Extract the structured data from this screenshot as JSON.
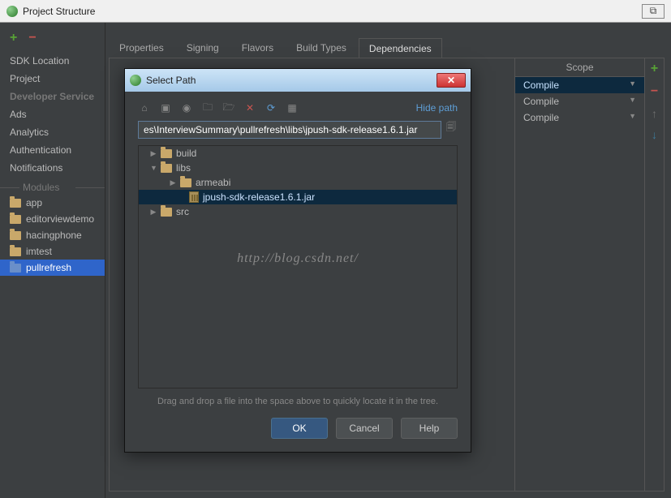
{
  "window": {
    "title": "Project Structure",
    "close": "⧉"
  },
  "sidebar": {
    "items": [
      "SDK Location",
      "Project"
    ],
    "dev_services_header": "Developer Service",
    "dev_services": [
      "Ads",
      "Analytics",
      "Authentication",
      "Notifications"
    ],
    "modules_header": "Modules",
    "modules": [
      "app",
      "editorviewdemo",
      "hacingphone",
      "imtest",
      "pullrefresh"
    ]
  },
  "tabs": [
    "Properties",
    "Signing",
    "Flavors",
    "Build Types",
    "Dependencies"
  ],
  "scope": {
    "header": "Scope",
    "rows": [
      "Compile",
      "Compile",
      "Compile"
    ]
  },
  "modal": {
    "title": "Select Path",
    "hide_path": "Hide path",
    "path": "es\\InterviewSummary\\pullrefresh\\libs\\jpush-sdk-release1.6.1.jar",
    "tree": {
      "build": "build",
      "libs": "libs",
      "armeabi": "armeabi",
      "jar": "jpush-sdk-release1.6.1.jar",
      "src": "src"
    },
    "drop_hint": "Drag and drop a file into the space above to quickly locate it in the tree.",
    "ok": "OK",
    "cancel": "Cancel",
    "help": "Help"
  },
  "watermark": "http://blog.csdn.net/"
}
